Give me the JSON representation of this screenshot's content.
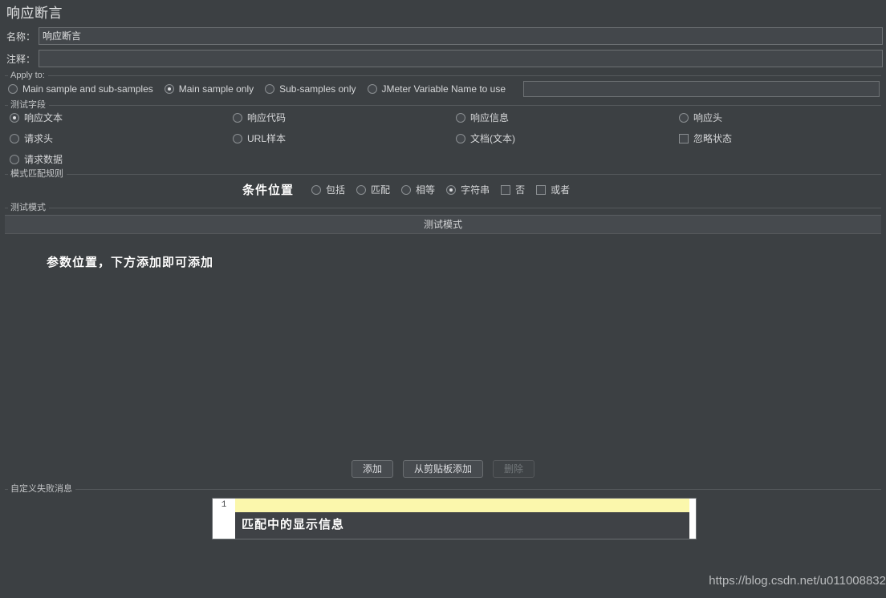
{
  "window": {
    "title": "响应断言"
  },
  "fields": {
    "name_label": "名称：",
    "name_value": "响应断言",
    "comment_label": "注释：",
    "comment_value": "",
    "comment_placeholder": ""
  },
  "apply_to": {
    "group_title": "Apply to:",
    "options": [
      {
        "label": "Main sample and sub-samples",
        "selected": false
      },
      {
        "label": "Main sample only",
        "selected": true
      },
      {
        "label": "Sub-samples only",
        "selected": false
      },
      {
        "label": "JMeter Variable Name to use",
        "selected": false
      }
    ],
    "variable_value": ""
  },
  "test_field": {
    "group_title": "测试字段",
    "options": [
      {
        "label": "响应文本",
        "type": "radio",
        "selected": true
      },
      {
        "label": "响应代码",
        "type": "radio",
        "selected": false
      },
      {
        "label": "响应信息",
        "type": "radio",
        "selected": false
      },
      {
        "label": "响应头",
        "type": "radio",
        "selected": false
      },
      {
        "label": "请求头",
        "type": "radio",
        "selected": false
      },
      {
        "label": "URL样本",
        "type": "radio",
        "selected": false
      },
      {
        "label": "文档(文本)",
        "type": "radio",
        "selected": false
      },
      {
        "label": "忽略状态",
        "type": "checkbox",
        "selected": false
      },
      {
        "label": "请求数据",
        "type": "radio",
        "selected": false
      }
    ]
  },
  "pattern_rules": {
    "group_title": "模式匹配规则",
    "annotation": "条件位置",
    "options": [
      {
        "label": "包括",
        "type": "radio",
        "selected": false
      },
      {
        "label": "匹配",
        "type": "radio",
        "selected": false
      },
      {
        "label": "相等",
        "type": "radio",
        "selected": false
      },
      {
        "label": "字符串",
        "type": "radio",
        "selected": true
      },
      {
        "label": "否",
        "type": "checkbox",
        "selected": false
      },
      {
        "label": "或者",
        "type": "checkbox",
        "selected": false
      }
    ]
  },
  "test_pattern": {
    "group_title": "测试模式",
    "column_header": "测试模式",
    "annotation": "参数位置，下方添加即可添加",
    "rows": []
  },
  "buttons": {
    "add": "添加",
    "add_from_clipboard": "从剪贴板添加",
    "delete": "删除"
  },
  "failure_message": {
    "group_title": "自定义失败消息",
    "line_number": "1",
    "value": "",
    "annotation": "匹配中的显示信息"
  },
  "watermark": "https://blog.csdn.net/u011008832"
}
